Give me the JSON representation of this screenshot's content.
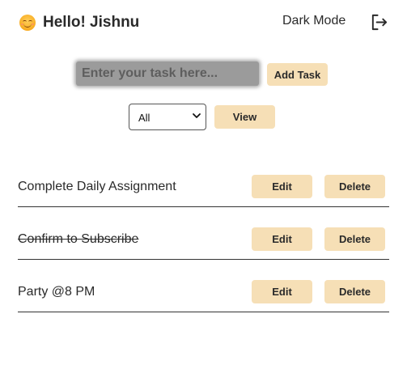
{
  "header": {
    "emoji_icon": "smiling-face-icon",
    "greeting": "Hello! Jishnu",
    "dark_mode_label": "Dark Mode",
    "logout_icon": "logout-icon"
  },
  "task_form": {
    "placeholder": "Enter your task here...",
    "value": "",
    "add_label": "Add Task"
  },
  "filter": {
    "selected": "All",
    "view_label": "View"
  },
  "tasks": [
    {
      "text": "Complete Daily Assignment",
      "completed": false,
      "edit_label": "Edit",
      "delete_label": "Delete"
    },
    {
      "text": "Confirm to Subscribe",
      "completed": true,
      "edit_label": "Edit",
      "delete_label": "Delete"
    },
    {
      "text": "Party @8 PM",
      "completed": false,
      "edit_label": "Edit",
      "delete_label": "Delete"
    }
  ],
  "colors": {
    "button_bg": "#f6dfb6",
    "input_bg": "#9b9b9b",
    "text": "#2a2a2a"
  }
}
